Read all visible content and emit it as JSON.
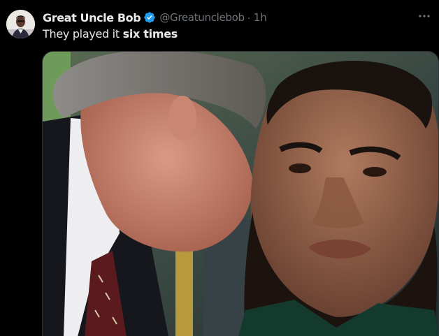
{
  "tweet": {
    "author": {
      "display_name": "Great Uncle Bob",
      "handle": "@Greatunclebob",
      "verified": true,
      "avatar_icon": "avatar-image"
    },
    "separator": "·",
    "time": "1h",
    "text": {
      "prefix": "They played it ",
      "bold": "six times"
    },
    "more_icon": "ellipsis-icon",
    "media": {
      "kind": "photo",
      "description_icon": "meme-photo"
    }
  },
  "colors": {
    "background": "#000000",
    "primary_text": "#e7e9ea",
    "secondary_text": "#71767b",
    "verified": "#1d9bf0",
    "border": "#2f3336"
  }
}
